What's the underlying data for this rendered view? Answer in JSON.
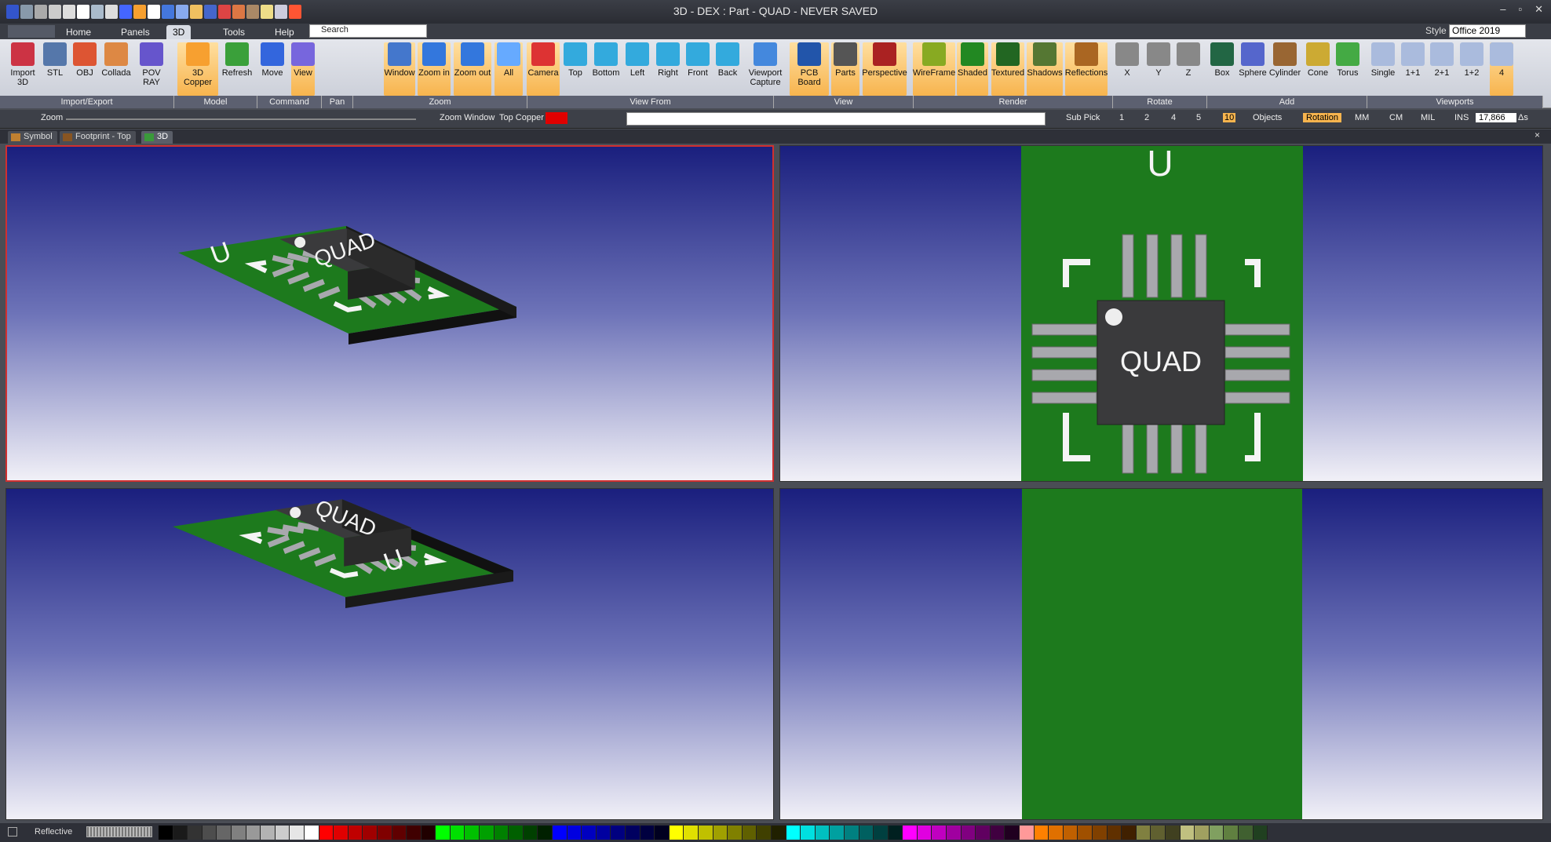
{
  "titlebar": {
    "title": "3D - DEX : Part - QUAD - NEVER SAVED",
    "window_buttons": [
      "–",
      "▫",
      "✕"
    ]
  },
  "style": {
    "label": "Style",
    "value": "Office 2019"
  },
  "menus": [
    "Home",
    "Panels",
    "3D",
    "Tools",
    "Help"
  ],
  "search": {
    "placeholder": "Search"
  },
  "ribbon": {
    "buttons": [
      "Import 3D",
      "STL",
      "OBJ",
      "Collada",
      "POV RAY",
      "3D Copper",
      "Refresh",
      "Move",
      "View",
      "Window",
      "Zoom in",
      "Zoom out",
      "All",
      "Camera",
      "Top",
      "Bottom",
      "Left",
      "Right",
      "Front",
      "Back",
      "Viewport Capture",
      "PCB Board",
      "Parts",
      "Perspective",
      "WireFrame",
      "Shaded",
      "Textured",
      "Shadows",
      "Reflections",
      "X",
      "Y",
      "Z",
      "Box",
      "Sphere",
      "Cylinder",
      "Cone",
      "Torus",
      "Single",
      "1+1",
      "2+1",
      "1+2",
      "4"
    ],
    "groups": [
      "Import/Export",
      "Model",
      "Command",
      "Pan",
      "Zoom",
      "View From",
      "View",
      "Render",
      "Rotate",
      "Add",
      "Viewports"
    ]
  },
  "toolbar2": {
    "zoom_label": "Zoom",
    "zoom_window": "Zoom Window",
    "layer": "Top Copper",
    "layer_color": "#e00000",
    "sub_pick": "Sub Pick",
    "pick_levels": [
      "1",
      "2",
      "4",
      "5",
      "10"
    ],
    "objects": "Objects",
    "rotation": "Rotation",
    "units": [
      "MM",
      "CM",
      "MIL",
      "INS"
    ],
    "coord_value": "17,866",
    "delta": "Δs"
  },
  "doc_tabs": [
    "Symbol",
    "Footprint - Top",
    "3D"
  ],
  "viewports": {
    "chip_label": "QUAD",
    "silk_label": "U"
  },
  "status": {
    "reflective": "Reflective"
  },
  "colors": {
    "pcb_green": "#1d7a1d",
    "chip": "#3a3a3c",
    "pin": "#a8a8ad",
    "silk": "#f4f4f4"
  },
  "palette": [
    "#000000",
    "#1a1a1a",
    "#333333",
    "#4d4d4d",
    "#666666",
    "#808080",
    "#999999",
    "#b3b3b3",
    "#cccccc",
    "#e6e6e6",
    "#ffffff",
    "#ff0000",
    "#e00000",
    "#c00000",
    "#a00000",
    "#800000",
    "#600000",
    "#400000",
    "#200000",
    "#00ff00",
    "#00e000",
    "#00c000",
    "#00a000",
    "#008000",
    "#006000",
    "#004000",
    "#002000",
    "#0000ff",
    "#0000e0",
    "#0000c0",
    "#0000a0",
    "#000080",
    "#000060",
    "#000040",
    "#000020",
    "#ffff00",
    "#e0e000",
    "#c0c000",
    "#a0a000",
    "#808000",
    "#606000",
    "#404000",
    "#202000",
    "#00ffff",
    "#00e0e0",
    "#00c0c0",
    "#00a0a0",
    "#008080",
    "#006060",
    "#004040",
    "#002020",
    "#ff00ff",
    "#e000e0",
    "#c000c0",
    "#a000a0",
    "#800080",
    "#600060",
    "#400040",
    "#200020",
    "#ff9999",
    "#ff8000",
    "#e07000",
    "#c06000",
    "#a05000",
    "#804000",
    "#603000",
    "#402000",
    "#808040",
    "#606030",
    "#404020",
    "#c0c080",
    "#a0a060",
    "#80a060",
    "#608040",
    "#406030",
    "#204020"
  ]
}
